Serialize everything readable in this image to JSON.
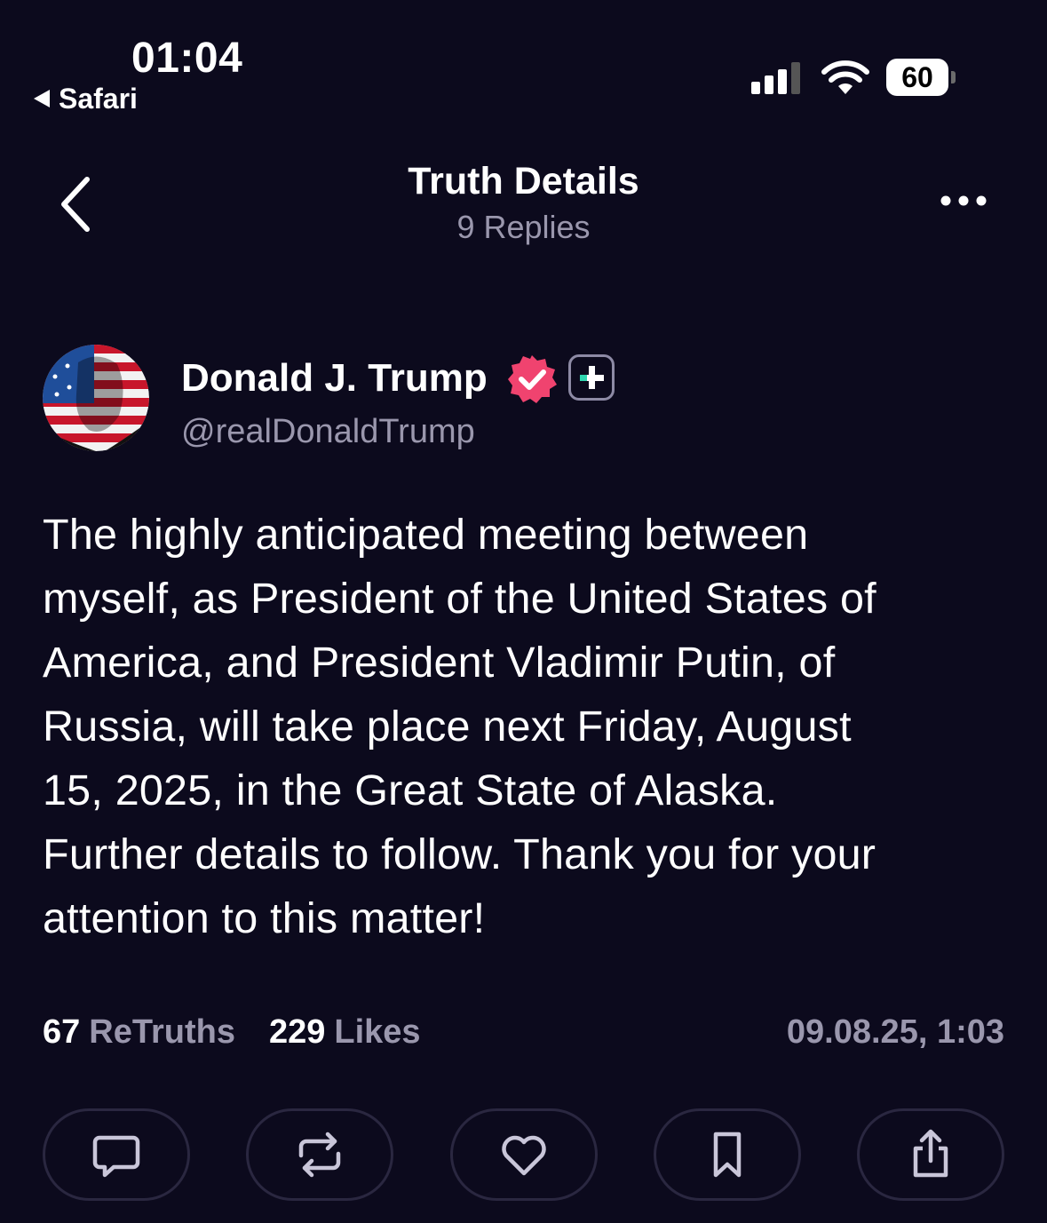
{
  "status_bar": {
    "time": "01:04",
    "back_app": "Safari",
    "battery": "60"
  },
  "header": {
    "title": "Truth Details",
    "subtitle": "9 Replies"
  },
  "post": {
    "author_name": "Donald J. Trump",
    "author_handle": "@realDonaldTrump",
    "text": "The highly anticipated meeting between\nmyself, as President of the United States of\nAmerica, and President Vladimir Putin, of\nRussia, will take place next Friday, August\n15, 2025, in the Great State of Alaska.\nFurther details to follow. Thank you for your\nattention to this matter!",
    "retruths_count": "67",
    "retruths_label": "ReTruths",
    "likes_count": "229",
    "likes_label": "Likes",
    "timestamp": "09.08.25, 1:03"
  },
  "colors": {
    "background": "#0c0a1d",
    "muted_text": "#9a97ad",
    "verified_badge": "#f0436f",
    "plus_accent": "#2fd6b0"
  },
  "icons": {
    "back": "chevron-left-icon",
    "more": "ellipsis-icon",
    "verified": "verified-badge-icon",
    "plus": "truth-plus-icon",
    "actions": [
      "reply-icon",
      "retruth-icon",
      "heart-icon",
      "bookmark-icon",
      "share-icon"
    ]
  }
}
